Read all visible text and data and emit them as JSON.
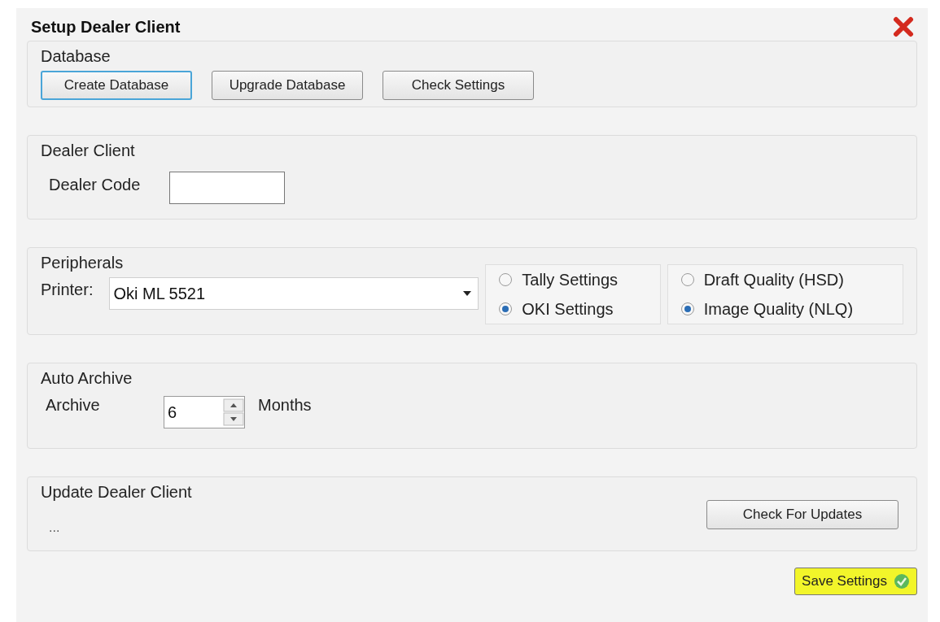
{
  "dialog": {
    "title": "Setup Dealer Client"
  },
  "database": {
    "title": "Database",
    "buttons": [
      {
        "label": "Create Database",
        "focused": true
      },
      {
        "label": "Upgrade Database",
        "focused": false
      },
      {
        "label": "Check Settings",
        "focused": false
      }
    ]
  },
  "dealer_client": {
    "title": "Dealer Client",
    "label": "Dealer Code"
  },
  "peripherals": {
    "title": "Peripherals",
    "printer_label": "Printer:",
    "printer_value": "Oki ML 5521",
    "settings_options": [
      {
        "label": "Tally Settings",
        "selected": false
      },
      {
        "label": "OKI Settings",
        "selected": true
      }
    ],
    "quality_options": [
      {
        "label": "Draft Quality (HSD)",
        "selected": false
      },
      {
        "label": "Image Quality (NLQ)",
        "selected": true
      }
    ]
  },
  "auto_archive": {
    "title": "Auto Archive",
    "label": "Archive",
    "value": "6",
    "unit": "Months"
  },
  "update": {
    "title": "Update Dealer Client",
    "status": "...",
    "button": "Check For Updates"
  },
  "save_button": {
    "label": "Save Settings",
    "highlighted": true
  }
}
